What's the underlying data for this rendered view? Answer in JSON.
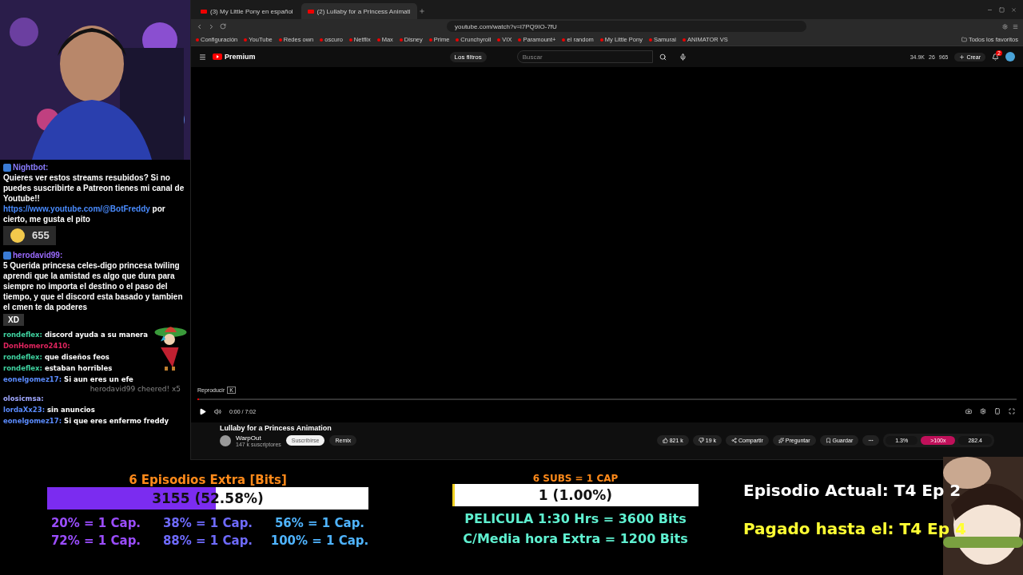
{
  "chat": {
    "messages": [
      {
        "kind": "bot",
        "user": "Nightbot:",
        "color": "#8a7dff",
        "text": "Quieres ver estos streams resubidos? Si no puedes suscribirte a Patreon tienes mi canal de Youtube!! ",
        "link": "https://www.youtube.com/@BotFreddy",
        "after": " por cierto, me gusta el pito",
        "emote_count": "655"
      },
      {
        "kind": "bot",
        "user": "herodavid99:",
        "color": "#9b6bff",
        "text": "5 Querida princesa celes-digo princesa twiling aprendi que la amistad es algo que dura para siempre no importa el destino o el paso del tiempo, y que el discord esta basado y tambien el cmen te da poderes",
        "emote_label": "XD"
      },
      {
        "kind": "user",
        "user": "rondeflex:",
        "color": "#3fd3a0",
        "text": "discord ayuda a su manera"
      },
      {
        "kind": "user",
        "user": "DonHomero2410:",
        "color": "#e0245e"
      },
      {
        "kind": "user",
        "user": "rondeflex:",
        "color": "#3fd3a0",
        "text": "que diseños feos"
      },
      {
        "kind": "user",
        "user": "rondeflex:",
        "color": "#3fd3a0",
        "text": "estaban horribles"
      },
      {
        "kind": "user",
        "user": "eonelgomez17:",
        "color": "#5b8cff",
        "text": "Si aun eres un efe"
      },
      {
        "kind": "user",
        "user": "olosicmsa:",
        "color": "#a0a8ff"
      },
      {
        "kind": "user",
        "user": "lordaXx23:",
        "color": "#5b8cff",
        "text": "sin anuncios"
      },
      {
        "kind": "user",
        "user": "eonelgomez17:",
        "color": "#5b8cff",
        "text": "Si que eres enfermo freddy"
      }
    ],
    "cheer": "herodavid99 cheered! x5"
  },
  "browser": {
    "tabs": [
      {
        "label": "(3) My Little Pony en español",
        "selected": false
      },
      {
        "label": "(2) Lullaby for a Princess Animati",
        "selected": true
      }
    ],
    "url": "youtube.com/watch?v=i7PQ9IO-7fU",
    "bookmarks": [
      "Configuración",
      "YouTube",
      "Redes own",
      "oscuro",
      "Netflix",
      "Max",
      "Disney",
      "Prime",
      "Crunchyroll",
      "VIX",
      "Paramount+",
      "el random",
      "My Little Pony",
      "Samurai",
      "ANIMATOR VS"
    ],
    "all_bookmarks": "Todos los favoritos"
  },
  "youtube": {
    "logo": "Premium",
    "filter": "Los filtros",
    "search": {
      "placeholder": "Buscar"
    },
    "stats": [
      "34.9K",
      "26",
      "965"
    ],
    "create": "Crear",
    "notifications": "2",
    "player": {
      "hint": "Reproducir",
      "hint_key": "K",
      "time": "0:00 / 7:02",
      "level": 0.0
    },
    "title": "Lullaby for a Princess Animation",
    "channel": "WarpOut",
    "subscribers": "147 k suscriptores",
    "subscribe": "Suscribirse",
    "remix": "Remix",
    "likes": "821 k",
    "dislikes": "19 k",
    "share": "Compartir",
    "ask": "Preguntar",
    "save": "Guardar",
    "metrics": [
      "1.3%",
      ">100x",
      "282.4"
    ]
  },
  "overlay": {
    "bits": {
      "title": "6 Episodios Extra [Bits]",
      "reading": "3155 (52.58%)",
      "level": 0.5258,
      "goals": [
        {
          "text": "20% = 1 Cap.",
          "color": "#9b4dff"
        },
        {
          "text": "38% = 1 Cap.",
          "color": "#6f6bff"
        },
        {
          "text": "56% = 1 Cap.",
          "color": "#4fb4ff"
        },
        {
          "text": "72% = 1 Cap.",
          "color": "#9b4dff"
        },
        {
          "text": "88% = 1 Cap.",
          "color": "#6f6bff"
        },
        {
          "text": "100% = 1 Cap.",
          "color": "#4fb4ff"
        }
      ]
    },
    "subs": {
      "title": "6 SUBS = 1 CAP",
      "reading": "1 (1.00%)",
      "level": 0.01,
      "lines": [
        "PELICULA 1:30 Hrs = 3600 Bits",
        "C/Media hora Extra = 1200 Bits"
      ]
    },
    "episode": {
      "current": "Episodio Actual: T4 Ep 2",
      "paid": "Pagado hasta el: T4 Ep 4"
    }
  }
}
